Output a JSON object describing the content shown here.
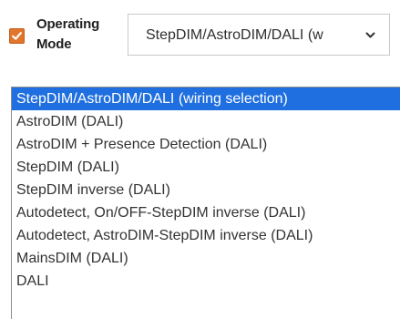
{
  "control": {
    "checked": true,
    "checkbox_color": "#e2742b",
    "label_line1": "Operating",
    "label_line2": "Mode",
    "selected_value": "StepDIM/AstroDIM/DALI (w",
    "arrow_icon": "chevron-down-icon"
  },
  "dropdown": {
    "highlight_color": "#1f6fe0",
    "options": [
      "StepDIM/AstroDIM/DALI (wiring selection)",
      "AstroDIM (DALI)",
      "AstroDIM + Presence Detection (DALI)",
      "StepDIM (DALI)",
      "StepDIM inverse (DALI)",
      "Autodetect, On/OFF-StepDIM inverse (DALI)",
      "Autodetect, AstroDIM-StepDIM inverse (DALI)",
      "MainsDIM (DALI)",
      "DALI"
    ]
  }
}
